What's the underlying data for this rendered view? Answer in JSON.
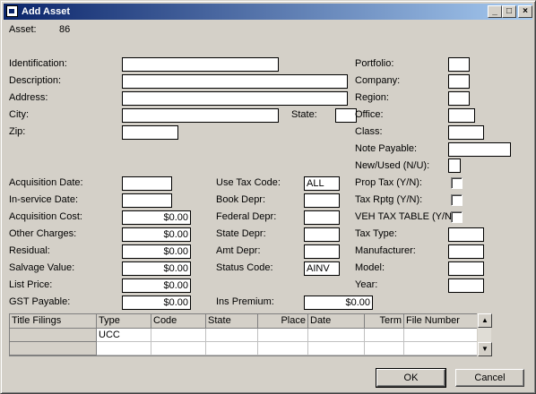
{
  "window": {
    "title": "Add Asset",
    "minimize": "_",
    "maximize": "□",
    "close": "×"
  },
  "asset": {
    "label": "Asset:",
    "value": "86"
  },
  "left": {
    "identification": "Identification:",
    "description": "Description:",
    "address": "Address:",
    "city": "City:",
    "state": "State:",
    "zip": "Zip:"
  },
  "right": {
    "portfolio": "Portfolio:",
    "company": "Company:",
    "region": "Region:",
    "office": "Office:",
    "class": "Class:",
    "note_payable": "Note Payable:",
    "new_used": "New/Used (N/U):",
    "prop_tax": "Prop Tax (Y/N):",
    "tax_rptg": "Tax Rptg (Y/N):",
    "veh_tax_table": "VEH TAX TABLE (Y/N",
    "tax_type": "Tax Type:",
    "manufacturer": "Manufacturer:",
    "model": "Model:",
    "year": "Year:"
  },
  "costs": {
    "acq_date": "Acquisition Date:",
    "inservice_date": "In-service Date:",
    "acq_cost": {
      "label": "Acquisition Cost:",
      "value": "$0.00"
    },
    "other_charges": {
      "label": "Other Charges:",
      "value": "$0.00"
    },
    "residual": {
      "label": "Residual:",
      "value": "$0.00"
    },
    "salvage": {
      "label": "Salvage Value:",
      "value": "$0.00"
    },
    "list_price": {
      "label": "List Price:",
      "value": "$0.00"
    },
    "gst_payable": {
      "label": "GST Payable:",
      "value": "$0.00"
    }
  },
  "depr": {
    "use_tax_code": {
      "label": "Use Tax Code:",
      "value": "ALL"
    },
    "book": "Book Depr:",
    "federal": "Federal Depr:",
    "state": "State Depr:",
    "amt": "Amt Depr:",
    "status_code": {
      "label": "Status Code:",
      "value": "AINV"
    },
    "ins_premium": {
      "label": "Ins Premium:",
      "value": "$0.00"
    }
  },
  "grid": {
    "columns": [
      "Title Filings",
      "Type",
      "Code",
      "State",
      "Place",
      "Date",
      "Term",
      "File Number"
    ],
    "rows": [
      [
        "",
        "UCC",
        "",
        "",
        "",
        "",
        "",
        ""
      ]
    ]
  },
  "buttons": {
    "ok": "OK",
    "cancel": "Cancel"
  }
}
